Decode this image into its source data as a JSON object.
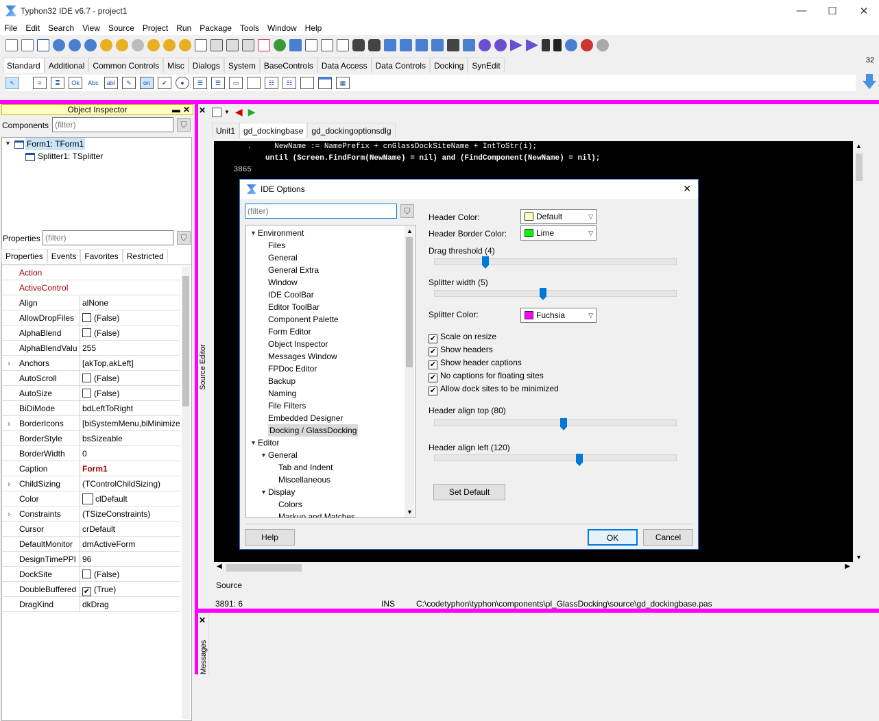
{
  "window": {
    "title": "Typhon32 IDE v6.7 - project1",
    "minimize": "—",
    "maximize": "☐",
    "close": "✕"
  },
  "menu": [
    "File",
    "Edit",
    "Search",
    "View",
    "Source",
    "Project",
    "Run",
    "Package",
    "Tools",
    "Window",
    "Help"
  ],
  "palette": {
    "tabs": [
      "Standard",
      "Additional",
      "Common Controls",
      "Misc",
      "Dialogs",
      "System",
      "BaseControls",
      "Data Access",
      "Data Controls",
      "Docking",
      "SynEdit"
    ],
    "active_tab": "Standard",
    "icon_texts": [
      "Ok",
      "Abc",
      "abI",
      "on"
    ],
    "badge": "32"
  },
  "object_inspector": {
    "title": "Object Inspector",
    "components_label": "Components",
    "components_filter": "(filter)",
    "tree": [
      "Form1: TForm1",
      "Splitter1: TSplitter"
    ],
    "properties_label": "Properties",
    "properties_filter": "(filter)",
    "tabs": [
      "Properties",
      "Events",
      "Favorites",
      "Restricted"
    ],
    "rows": [
      {
        "name": "Action",
        "value": "",
        "red": true
      },
      {
        "name": "ActiveControl",
        "value": "",
        "red": true
      },
      {
        "name": "Align",
        "value": "alNone"
      },
      {
        "name": "AllowDropFiles",
        "value": "(False)",
        "check": "off"
      },
      {
        "name": "AlphaBlend",
        "value": "(False)",
        "check": "off"
      },
      {
        "name": "AlphaBlendValu",
        "value": "255"
      },
      {
        "name": "Anchors",
        "value": "[akTop,akLeft]",
        "expand": true
      },
      {
        "name": "AutoScroll",
        "value": "(False)",
        "check": "off"
      },
      {
        "name": "AutoSize",
        "value": "(False)",
        "check": "off"
      },
      {
        "name": "BiDiMode",
        "value": "bdLeftToRight"
      },
      {
        "name": "BorderIcons",
        "value": "[biSystemMenu,biMinimize",
        "expand": true
      },
      {
        "name": "BorderStyle",
        "value": "bsSizeable"
      },
      {
        "name": "BorderWidth",
        "value": "0"
      },
      {
        "name": "Caption",
        "value": "Form1",
        "boldred": true
      },
      {
        "name": "ChildSizing",
        "value": "(TControlChildSizing)",
        "expand": true
      },
      {
        "name": "Color",
        "value": "clDefault",
        "swatch": true
      },
      {
        "name": "Constraints",
        "value": "(TSizeConstraints)",
        "expand": true
      },
      {
        "name": "Cursor",
        "value": "crDefault"
      },
      {
        "name": "DefaultMonitor",
        "value": "dmActiveForm"
      },
      {
        "name": "DesignTimePPI",
        "value": "96"
      },
      {
        "name": "DockSite",
        "value": "(False)",
        "check": "off"
      },
      {
        "name": "DoubleBuffered",
        "value": "(True)",
        "check": "on"
      },
      {
        "name": "DragKind",
        "value": "dkDrag"
      }
    ]
  },
  "source_editor": {
    "side_label": "Source Editor",
    "tabs": [
      "Unit1",
      "gd_dockingbase",
      "gd_dockingoptionsdlg"
    ],
    "active_tab": "gd_dockingbase",
    "lines": [
      {
        "gutter": ".",
        "text": "  NewName := NamePrefix + cnGlassDockSiteName + IntToStr(i);"
      },
      {
        "gutter": "",
        "text": "until (Screen.FindForm(NewName) = nil) and (FindComponent(NewName) = nil);"
      },
      {
        "gutter": "3865",
        "text": ""
      }
    ],
    "gutter_partials": [
      "38",
      "38",
      "38",
      "38",
      "38",
      "38",
      "38"
    ],
    "bottom_tab": "Source",
    "status": {
      "pos": "3891:  6",
      "mode": "INS",
      "file": "C:\\codetyphon\\typhon\\components\\pl_GlassDocking\\source\\gd_dockingbase.pas"
    }
  },
  "dialog": {
    "title": "IDE Options",
    "close": "✕",
    "filter": "(filter)",
    "tree": [
      {
        "label": "Environment",
        "level": 0,
        "toggle": "open"
      },
      {
        "label": "Files",
        "level": 1
      },
      {
        "label": "General",
        "level": 1
      },
      {
        "label": "General Extra",
        "level": 1
      },
      {
        "label": "Window",
        "level": 1
      },
      {
        "label": "IDE CoolBar",
        "level": 1
      },
      {
        "label": "Editor ToolBar",
        "level": 1
      },
      {
        "label": "Component Palette",
        "level": 1
      },
      {
        "label": "Form Editor",
        "level": 1
      },
      {
        "label": "Object Inspector",
        "level": 1
      },
      {
        "label": "Messages Window",
        "level": 1
      },
      {
        "label": "FPDoc Editor",
        "level": 1
      },
      {
        "label": "Backup",
        "level": 1
      },
      {
        "label": "Naming",
        "level": 1
      },
      {
        "label": "File Filters",
        "level": 1
      },
      {
        "label": "Embedded Designer",
        "level": 1
      },
      {
        "label": "Docking / GlassDocking",
        "level": 1,
        "selected": true
      },
      {
        "label": "Editor",
        "level": 0,
        "toggle": "open"
      },
      {
        "label": "General",
        "level": 1,
        "toggle": "open"
      },
      {
        "label": "Tab and Indent",
        "level": 2
      },
      {
        "label": "Miscellaneous",
        "level": 2
      },
      {
        "label": "Display",
        "level": 1,
        "toggle": "open"
      },
      {
        "label": "Colors",
        "level": 2
      },
      {
        "label": "Markup and Matches",
        "level": 2
      }
    ],
    "header_color_label": "Header Color:",
    "header_color_value": "Default",
    "header_color_hex": "#ffffc0",
    "header_border_label": "Header Border Color:",
    "header_border_value": "Lime",
    "header_border_hex": "#00ff00",
    "drag_threshold_label": "Drag threshold (4)",
    "splitter_width_label": "Splitter width (5)",
    "splitter_color_label": "Splitter Color:",
    "splitter_color_value": "Fuchsia",
    "splitter_color_hex": "#ff00ff",
    "checks": [
      {
        "label": "Scale on resize",
        "checked": true
      },
      {
        "label": "Show headers",
        "checked": true
      },
      {
        "label": "Show header captions",
        "checked": true
      },
      {
        "label": "No captions for floating sites",
        "checked": true
      },
      {
        "label": "Allow dock sites to be minimized",
        "checked": true
      }
    ],
    "align_top_label": "Header align top (80)",
    "align_left_label": "Header align left (120)",
    "set_default": "Set Default",
    "help": "Help",
    "ok": "OK",
    "cancel": "Cancel"
  },
  "messages": {
    "side_label": "Messages"
  }
}
